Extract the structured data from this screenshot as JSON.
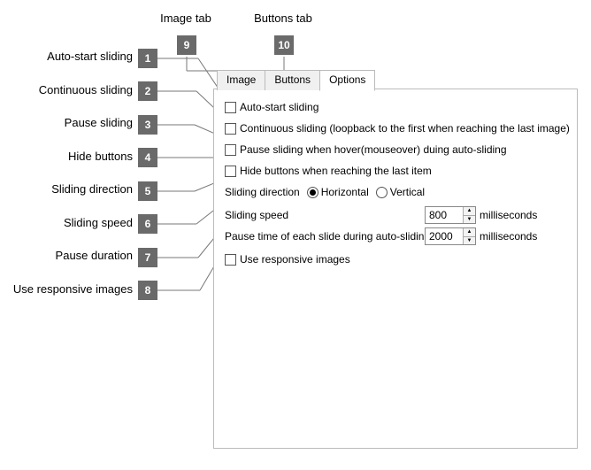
{
  "callouts": {
    "top": {
      "image_tab": {
        "num": "9",
        "label": "Image tab"
      },
      "buttons_tab": {
        "num": "10",
        "label": "Buttons tab"
      }
    },
    "side": {
      "1": {
        "num": "1",
        "label": "Auto-start sliding"
      },
      "2": {
        "num": "2",
        "label": "Continuous sliding"
      },
      "3": {
        "num": "3",
        "label": "Pause sliding"
      },
      "4": {
        "num": "4",
        "label": "Hide buttons"
      },
      "5": {
        "num": "5",
        "label": "Sliding direction"
      },
      "6": {
        "num": "6",
        "label": "Sliding speed"
      },
      "7": {
        "num": "7",
        "label": "Pause duration"
      },
      "8": {
        "num": "8",
        "label": "Use responsive images"
      }
    }
  },
  "tabs": {
    "image": "Image",
    "buttons": "Buttons",
    "options": "Options"
  },
  "options": {
    "auto_start": "Auto-start sliding",
    "continuous": "Continuous sliding (loopback to the first when reaching the last image)",
    "pause_hover": "Pause sliding when hover(mouseover) duing auto-sliding",
    "hide_buttons": "Hide buttons when reaching the last item",
    "direction_label": "Sliding direction",
    "horizontal": "Horizontal",
    "vertical": "Vertical",
    "speed_label": "Sliding speed",
    "speed_value": "800",
    "ms": "milliseconds",
    "pause_label": "Pause time of each slide during auto-sliding",
    "pause_value": "2000",
    "responsive": "Use responsive images"
  }
}
